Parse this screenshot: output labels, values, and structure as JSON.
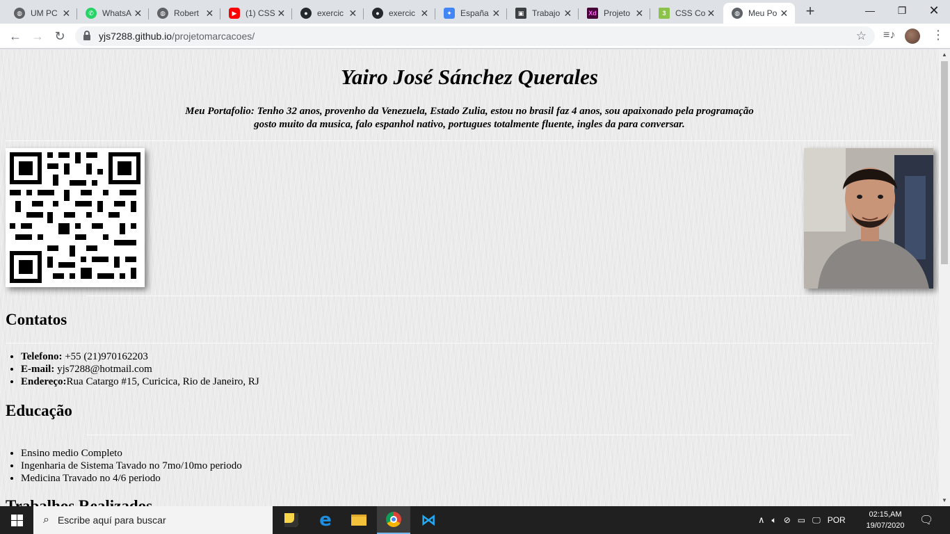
{
  "browser": {
    "tabs": [
      {
        "title": "UM PC",
        "icon": "globe-icon"
      },
      {
        "title": "WhatsA",
        "icon": "whatsapp-icon"
      },
      {
        "title": "Robert",
        "icon": "globe-icon"
      },
      {
        "title": "(1) CSS",
        "icon": "youtube-icon"
      },
      {
        "title": "exercic",
        "icon": "github-icon"
      },
      {
        "title": "exercic",
        "icon": "github-icon"
      },
      {
        "title": "España",
        "icon": "puzzle-icon"
      },
      {
        "title": "Trabajo",
        "icon": "portrait-icon"
      },
      {
        "title": "Projeto",
        "icon": "xd-icon"
      },
      {
        "title": "CSS Co",
        "icon": "codepen-icon"
      },
      {
        "title": "Meu Po",
        "icon": "globe-icon"
      }
    ],
    "url_host": "yjs7288.github.io",
    "url_path": "/projetomarcacoes/"
  },
  "page": {
    "name": "Yairo José Sánchez Querales",
    "bio_line1": "Meu Portafolio: Tenho 32 anos, provenho da Venezuela, Estado Zulia, estou no brasil faz 4 anos, sou apaixonado pela programação",
    "bio_line2": "gosto muito da musica, falo espanhol nativo, portugues totalmente fluente, ingles da para conversar.",
    "contacts_heading": "Contatos",
    "contacts": [
      {
        "label": "Telefono:",
        "value": " +55 (21)970162203"
      },
      {
        "label": "E-mail:",
        "value": " yjs7288@hotmail.com"
      },
      {
        "label": "Endereço:",
        "value": "Rua Catargo #15, Curicica, Rio de Janeiro, RJ"
      }
    ],
    "education_heading": "Educação",
    "education": [
      "Ensino medio Completo",
      "Ingenharia de Sistema Tavado no 7mo/10mo periodo",
      "Medicina Travado no 4/6 periodo"
    ],
    "works_heading": "Trabalhos Realizados"
  },
  "taskbar": {
    "search_placeholder": "Escribe aquí para buscar",
    "language": "POR",
    "time": "02:15,AM",
    "date": "19/07/2020"
  },
  "colors": {
    "chrome_bg": "#dee1e6",
    "taskbar_bg": "#202020",
    "page_bg": "#ebebeb"
  }
}
